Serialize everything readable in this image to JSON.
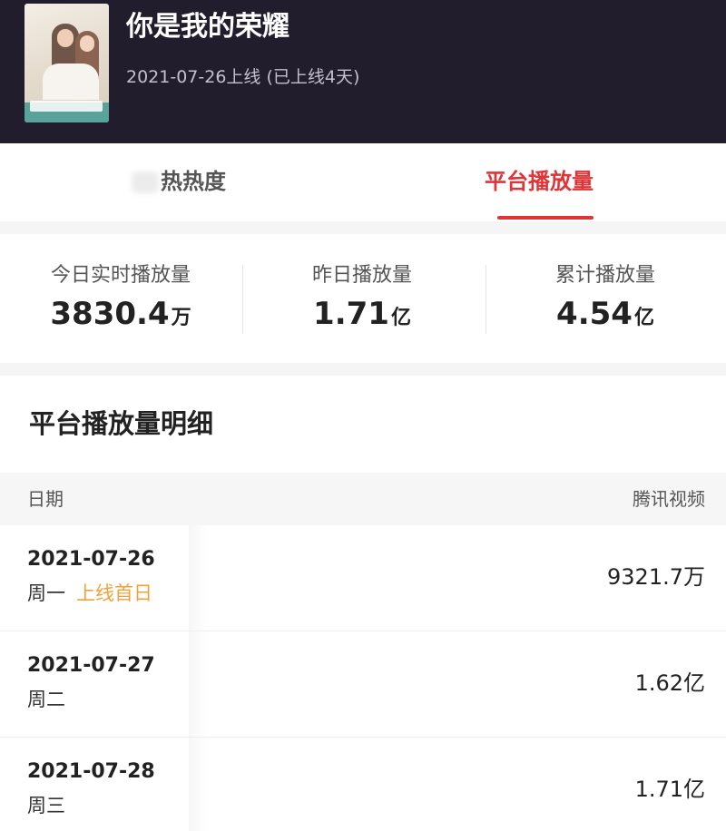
{
  "header": {
    "title": "你是我的荣耀",
    "release": "2021-07-26上线 (已上线4天)"
  },
  "tabs": {
    "heat_label": "热热度",
    "play_label": "平台播放量"
  },
  "stats": [
    {
      "label": "今日实时播放量",
      "value": "3830.4",
      "unit": "万"
    },
    {
      "label": "昨日播放量",
      "value": "1.71",
      "unit": "亿"
    },
    {
      "label": "累计播放量",
      "value": "4.54",
      "unit": "亿"
    }
  ],
  "detail": {
    "title": "平台播放量明细",
    "col_date": "日期",
    "col_platform": "腾讯视频",
    "rows": [
      {
        "date": "2021-07-26",
        "weekday": "周一",
        "tag": "上线首日",
        "value": "9321.7万"
      },
      {
        "date": "2021-07-27",
        "weekday": "周二",
        "tag": "",
        "value": "1.62亿"
      },
      {
        "date": "2021-07-28",
        "weekday": "周三",
        "tag": "",
        "value": "1.71亿"
      }
    ]
  },
  "colors": {
    "accent": "#e03437",
    "header_bg": "#211d2c",
    "tag": "#f0a23a"
  }
}
